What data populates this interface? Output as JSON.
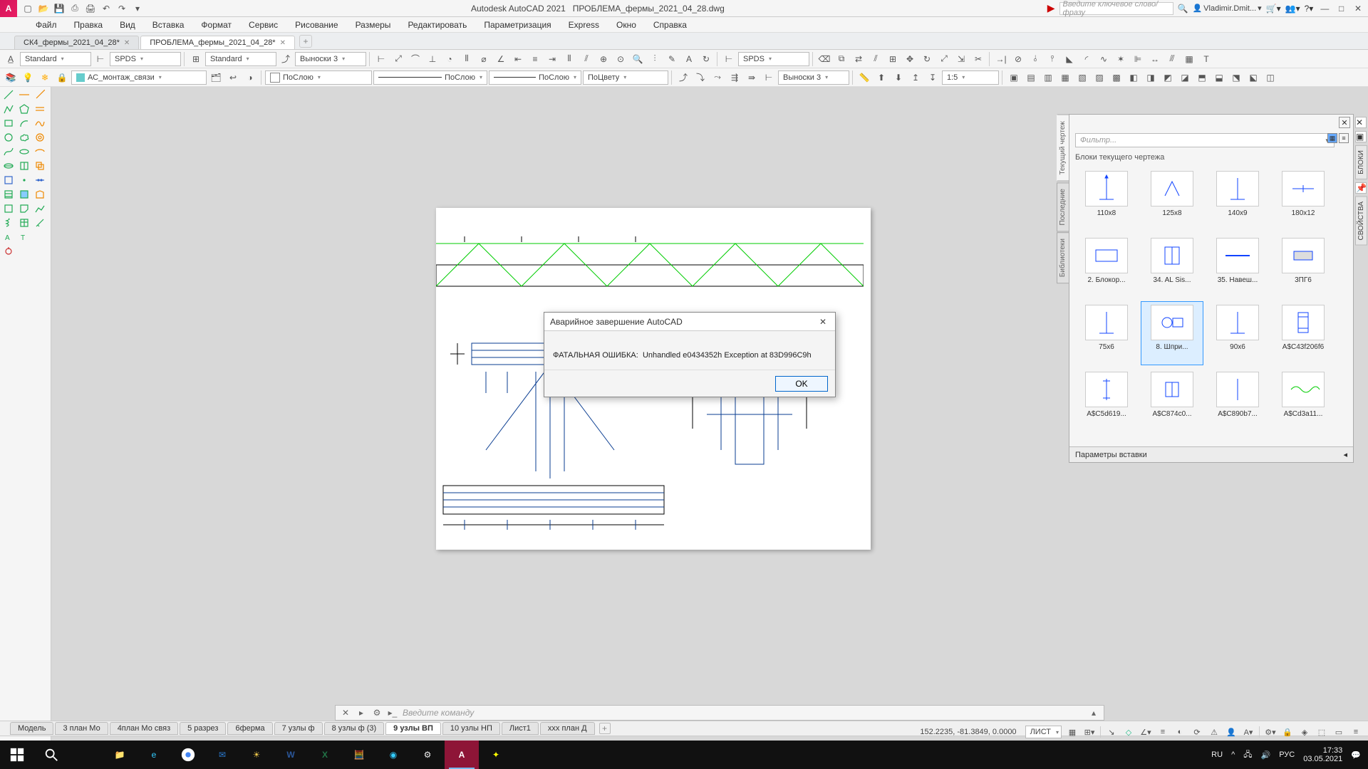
{
  "app": {
    "title_app": "Autodesk AutoCAD 2021",
    "title_doc": "ПРОБЛЕМА_фермы_2021_04_28.dwg",
    "search_placeholder": "Введите ключевое слово/фразу",
    "user": "Vladimir.Dmit..."
  },
  "menu": [
    "Файл",
    "Правка",
    "Вид",
    "Вставка",
    "Формат",
    "Сервис",
    "Рисование",
    "Размеры",
    "Редактировать",
    "Параметризация",
    "Express",
    "Окно",
    "Справка"
  ],
  "doc_tabs": [
    {
      "label": "СК4_фермы_2021_04_28*",
      "active": false
    },
    {
      "label": "ПРОБЛЕМА_фермы_2021_04_28*",
      "active": true
    }
  ],
  "tb1": {
    "style1": "Standard",
    "spds1": "SPDS",
    "style2": "Standard",
    "callout": "Выноски 3",
    "spds2": "SPDS"
  },
  "tb2": {
    "layer": "АС_монтаж_связи",
    "color": "ПоСлою",
    "linetype": "ПоСлою",
    "lineweight": "ПоСлою",
    "plotstyle": "ПоЦвету",
    "dimstyle": "Выноски 3",
    "scale": "1:5"
  },
  "dialog": {
    "title": "Аварийное завершение AutoCAD",
    "body_label": "ФАТАЛЬНАЯ ОШИБКА:",
    "body_msg": "Unhandled e0434352h Exception at 83D996C9h",
    "ok": "OK"
  },
  "cmd": {
    "placeholder": "Введите команду"
  },
  "layouts": [
    "Модель",
    "3 план Мо",
    "4план Мо связ",
    "5 разрез",
    "6ферма",
    "7 узлы ф",
    "8 узлы ф (3)",
    "9 узлы ВП",
    "10 узлы НП",
    "Лист1",
    "xxx план Д"
  ],
  "layout_active_index": 7,
  "status": {
    "coords": "152.2235, -81.3849, 0.0000",
    "space": "ЛИСТ"
  },
  "blocks": {
    "filter_placeholder": "Фильтр...",
    "subtitle": "Блоки текущего чертежа",
    "side_tabs": [
      "Текущий чертеж",
      "Последние",
      "Библиотеки"
    ],
    "side_active": 0,
    "right_rail_tabs": [
      "БЛОКИ",
      "СВОЙСТВА"
    ],
    "footer": "Параметры вставки",
    "items": [
      {
        "name": "110x8"
      },
      {
        "name": "125x8"
      },
      {
        "name": "140x9"
      },
      {
        "name": "180x12"
      },
      {
        "name": "2. Блокор..."
      },
      {
        "name": "34. AL Sis..."
      },
      {
        "name": "35. Навеш..."
      },
      {
        "name": "3ПГ6"
      },
      {
        "name": "75x6"
      },
      {
        "name": "8. Шпри...",
        "selected": true
      },
      {
        "name": "90x6"
      },
      {
        "name": "A$C43f206f6"
      },
      {
        "name": "A$C5d619..."
      },
      {
        "name": "A$C874c0..."
      },
      {
        "name": "A$C890b7..."
      },
      {
        "name": "A$Cd3a11..."
      }
    ]
  },
  "taskbar": {
    "lang": "RU",
    "ime": "РУС",
    "time": "17:33",
    "date": "03.05.2021"
  }
}
